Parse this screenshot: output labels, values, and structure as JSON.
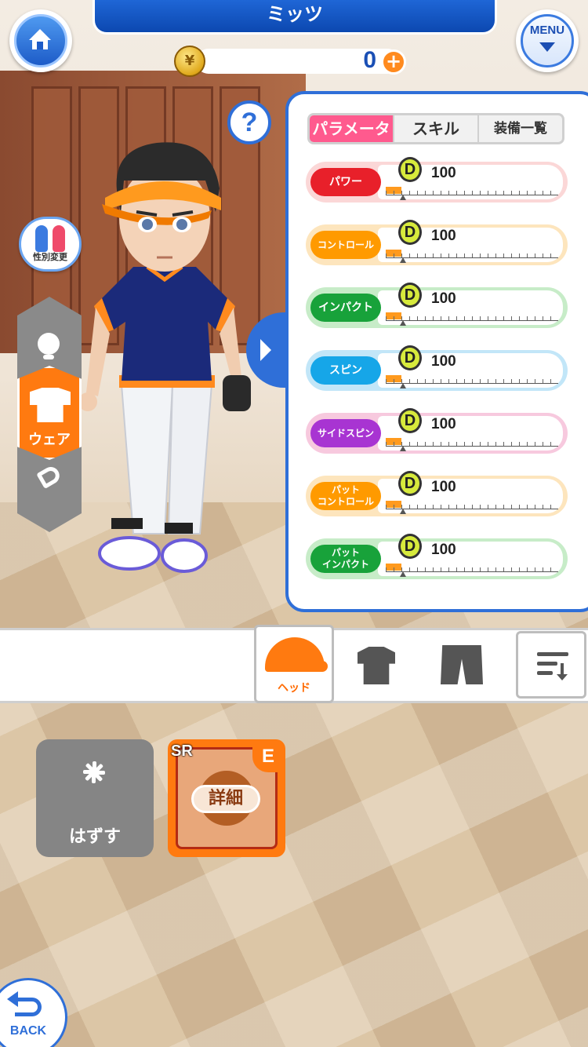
{
  "header": {
    "player_name": "ミッツ",
    "coin_count": "0",
    "coin_symbol": "¥",
    "plus_symbol": "+",
    "menu_label": "MENU"
  },
  "help_symbol": "?",
  "gender_label": "性別変更",
  "side_menu": {
    "active_label": "ウェア"
  },
  "tabs": [
    {
      "label": "パラメータ",
      "active": true
    },
    {
      "label": "スキル",
      "active": false
    },
    {
      "label": "装備一覧",
      "active": false
    }
  ],
  "stats": [
    {
      "label": "パワー",
      "rank": "D",
      "value": "100",
      "color": "#e8202a",
      "bg": "#fbd7d7"
    },
    {
      "label": "コントロール",
      "rank": "D",
      "value": "100",
      "color": "#ff9a00",
      "bg": "#fde5bd"
    },
    {
      "label": "インパクト",
      "rank": "D",
      "value": "100",
      "color": "#18a23a",
      "bg": "#c7ecc8"
    },
    {
      "label": "スピン",
      "rank": "D",
      "value": "100",
      "color": "#16a6e8",
      "bg": "#c2e6f8"
    },
    {
      "label": "サイドスピン",
      "rank": "D",
      "value": "100",
      "color": "#a834d2",
      "bg": "#f7c9de"
    },
    {
      "label": "パット コントロール",
      "rank": "D",
      "value": "100",
      "color": "#ff9a00",
      "bg": "#fde5bd"
    },
    {
      "label": "パット インパクト",
      "rank": "D",
      "value": "100",
      "color": "#18a23a",
      "bg": "#c7ecc8"
    }
  ],
  "categories": {
    "head_label": "ヘッド"
  },
  "items": {
    "remove_label": "はずす",
    "rarity": "SR",
    "equipped_badge": "E",
    "detail_label": "詳細"
  },
  "back_label": "BACK"
}
